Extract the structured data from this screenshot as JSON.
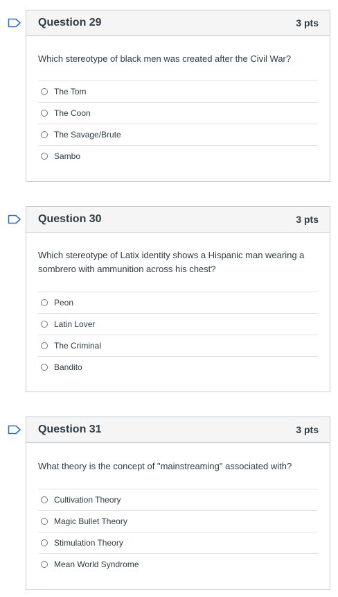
{
  "questions": [
    {
      "title": "Question 29",
      "points": "3 pts",
      "text": "Which stereotype of black men was created after the Civil War?",
      "answers": [
        "The Tom",
        "The Coon",
        "The Savage/Brute",
        "Sambo"
      ]
    },
    {
      "title": "Question 30",
      "points": "3 pts",
      "text": "Which stereotype of Latix identity shows a Hispanic man wearing a sombrero with ammunition across his chest?",
      "answers": [
        "Peon",
        "Latin Lover",
        "The Criminal",
        "Bandito"
      ]
    },
    {
      "title": "Question 31",
      "points": "3 pts",
      "text": "What theory is the concept of \"mainstreaming\" associated with?",
      "answers": [
        "Cultivation Theory",
        "Magic Bullet Theory",
        "Stimulation Theory",
        "Mean World Syndrome"
      ]
    }
  ],
  "colors": {
    "border": "#c7cdd1",
    "header_bg": "#f5f5f5",
    "text": "#2d3b45",
    "flag": "#2b6ec8"
  },
  "icons": {
    "flag": "flag-question-icon",
    "radio": "radio-button-icon"
  }
}
